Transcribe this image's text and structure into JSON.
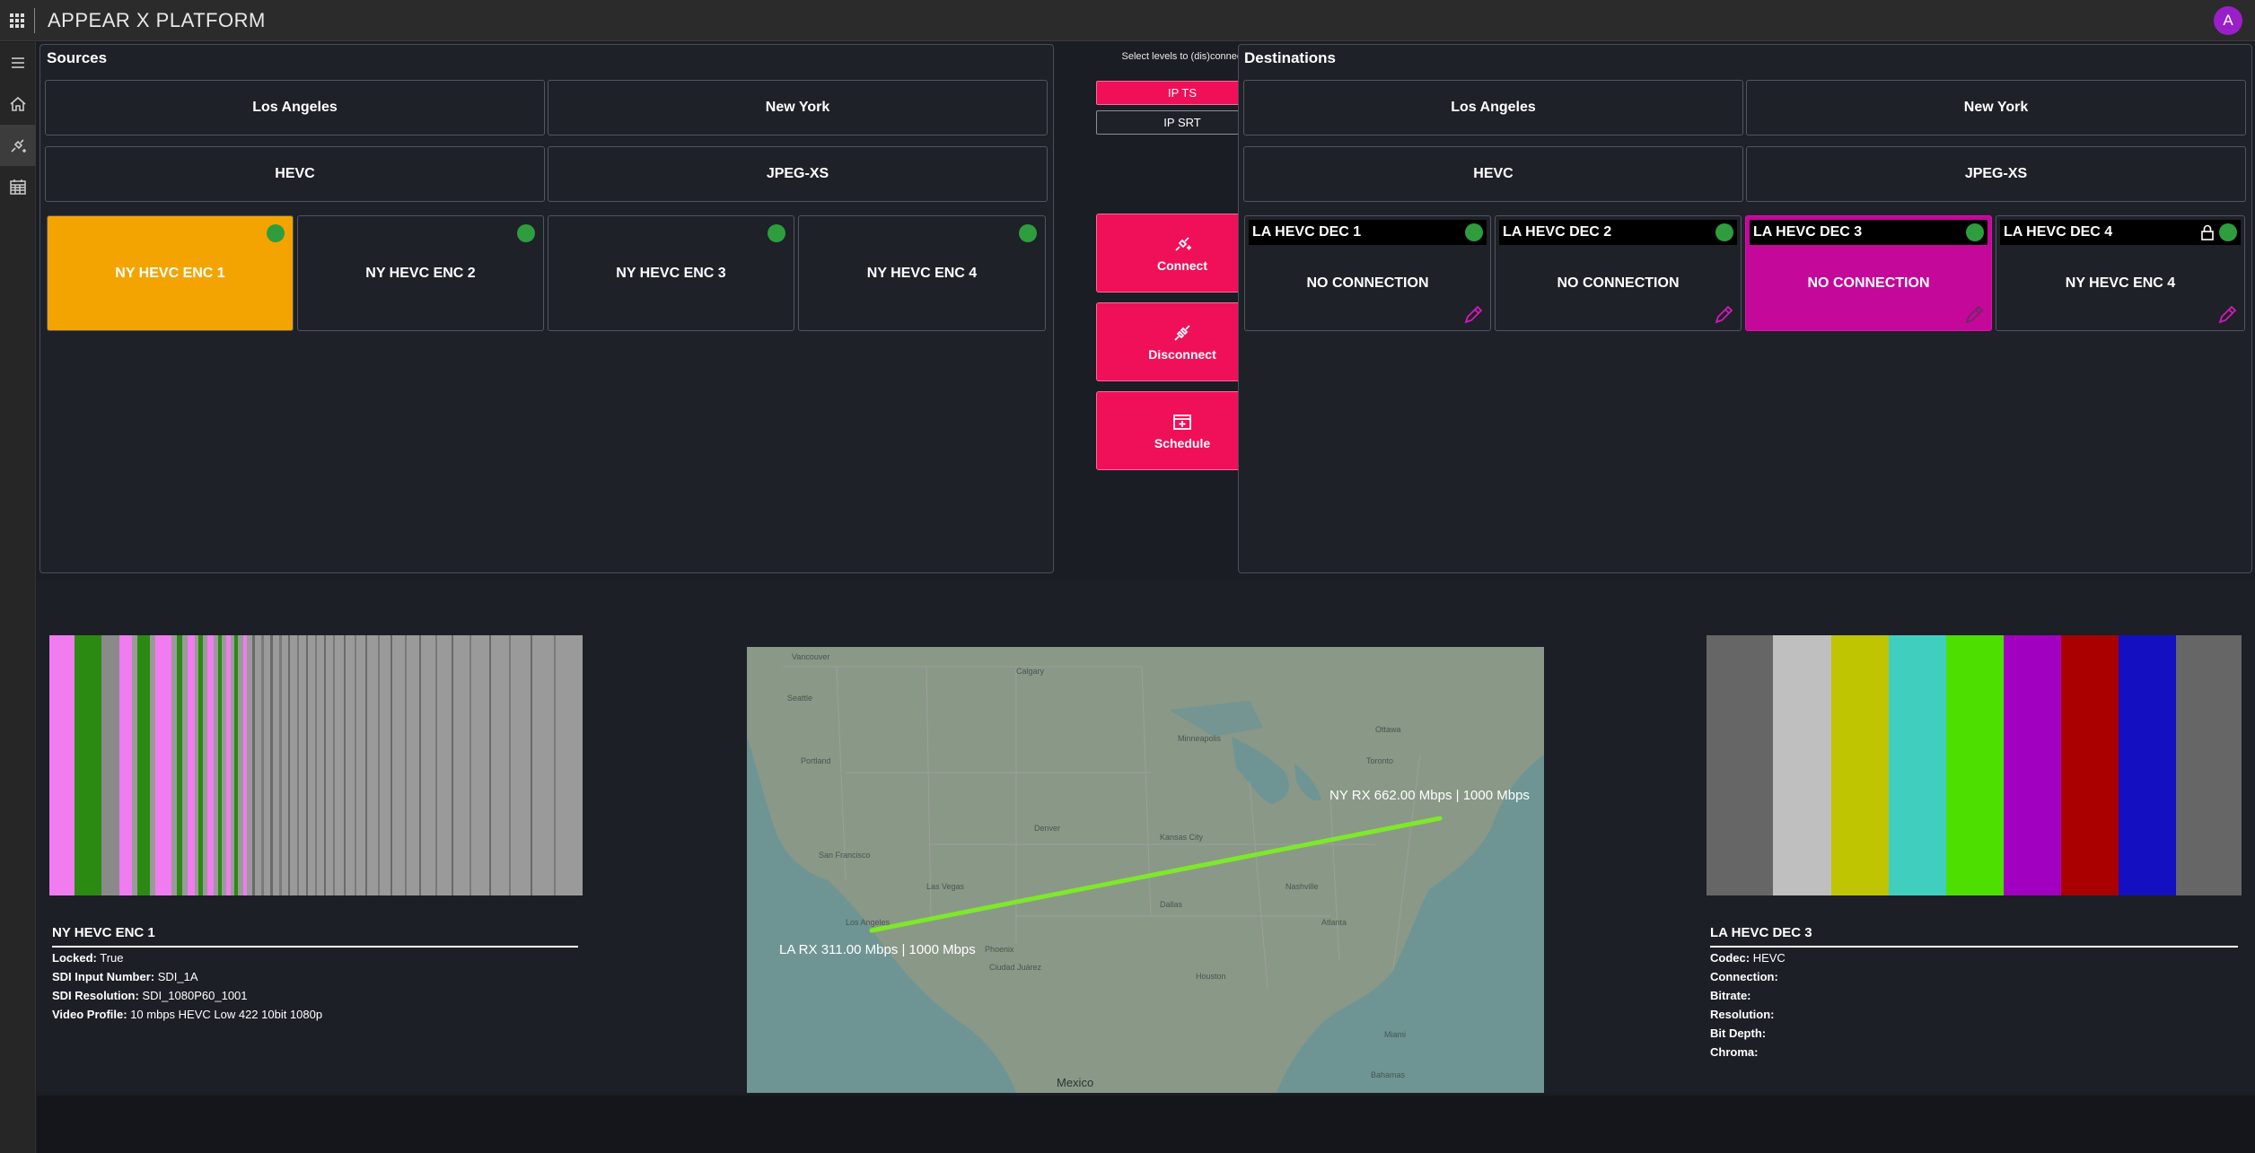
{
  "app": {
    "title": "APPEAR X PLATFORM",
    "avatar_initial": "A",
    "accent_color": "#f0105a",
    "brand_purple": "#9a1fc9"
  },
  "nav": {
    "items": [
      "menu-icon",
      "home-icon",
      "routing-icon",
      "calendar-icon"
    ],
    "active": "routing-icon"
  },
  "sources": {
    "title": "Sources",
    "locations": [
      "Los Angeles",
      "New York"
    ],
    "codecs": [
      "HEVC",
      "JPEG-XS"
    ],
    "tiles": [
      {
        "label": "NY HEVC ENC 1",
        "status": "online",
        "selected": true
      },
      {
        "label": "NY HEVC ENC 2",
        "status": "online",
        "selected": false
      },
      {
        "label": "NY HEVC ENC 3",
        "status": "online",
        "selected": false
      },
      {
        "label": "NY HEVC ENC 4",
        "status": "online",
        "selected": false
      }
    ]
  },
  "levels": {
    "hint": "Select levels to (dis)connect",
    "options": [
      {
        "label": "IP TS",
        "active": true
      },
      {
        "label": "IP SRT",
        "active": false
      }
    ]
  },
  "actions": {
    "connect": "Connect",
    "disconnect": "Disconnect",
    "schedule": "Schedule"
  },
  "destinations": {
    "title": "Destinations",
    "locations": [
      "Los Angeles",
      "New York"
    ],
    "codecs": [
      "HEVC",
      "JPEG-XS"
    ],
    "tiles": [
      {
        "label": "LA HEVC DEC 1",
        "connection": "NO CONNECTION",
        "status": "online",
        "locked": false,
        "selected": false
      },
      {
        "label": "LA HEVC DEC 2",
        "connection": "NO CONNECTION",
        "status": "online",
        "locked": false,
        "selected": false
      },
      {
        "label": "LA HEVC DEC 3",
        "connection": "NO CONNECTION",
        "status": "online",
        "locked": false,
        "selected": true
      },
      {
        "label": "LA HEVC DEC 4",
        "connection": "NY HEVC ENC 4",
        "status": "online",
        "locked": true,
        "selected": false
      }
    ]
  },
  "source_info": {
    "title": "NY HEVC ENC 1",
    "rows": [
      {
        "key": "Locked:",
        "value": "True"
      },
      {
        "key": "SDI Input Number:",
        "value": "SDI_1A"
      },
      {
        "key": "SDI Resolution:",
        "value": "SDI_1080P60_1001"
      },
      {
        "key": "Video Profile:",
        "value": "10 mbps HEVC Low 422 10bit 1080p"
      }
    ]
  },
  "destination_info": {
    "title": "LA HEVC DEC 3",
    "rows": [
      {
        "key": "Codec:",
        "value": "HEVC"
      },
      {
        "key": "Connection:",
        "value": ""
      },
      {
        "key": "Bitrate:",
        "value": ""
      },
      {
        "key": "Resolution:",
        "value": ""
      },
      {
        "key": "Bit Depth:",
        "value": ""
      },
      {
        "key": "Chroma:",
        "value": ""
      }
    ]
  },
  "map": {
    "ny_label": "NY RX 662.00 Mbps | 1000 Mbps",
    "la_label": "LA RX 311.00 Mbps | 1000 Mbps",
    "country_label": "Mexico",
    "link_color": "#7ee82a"
  }
}
